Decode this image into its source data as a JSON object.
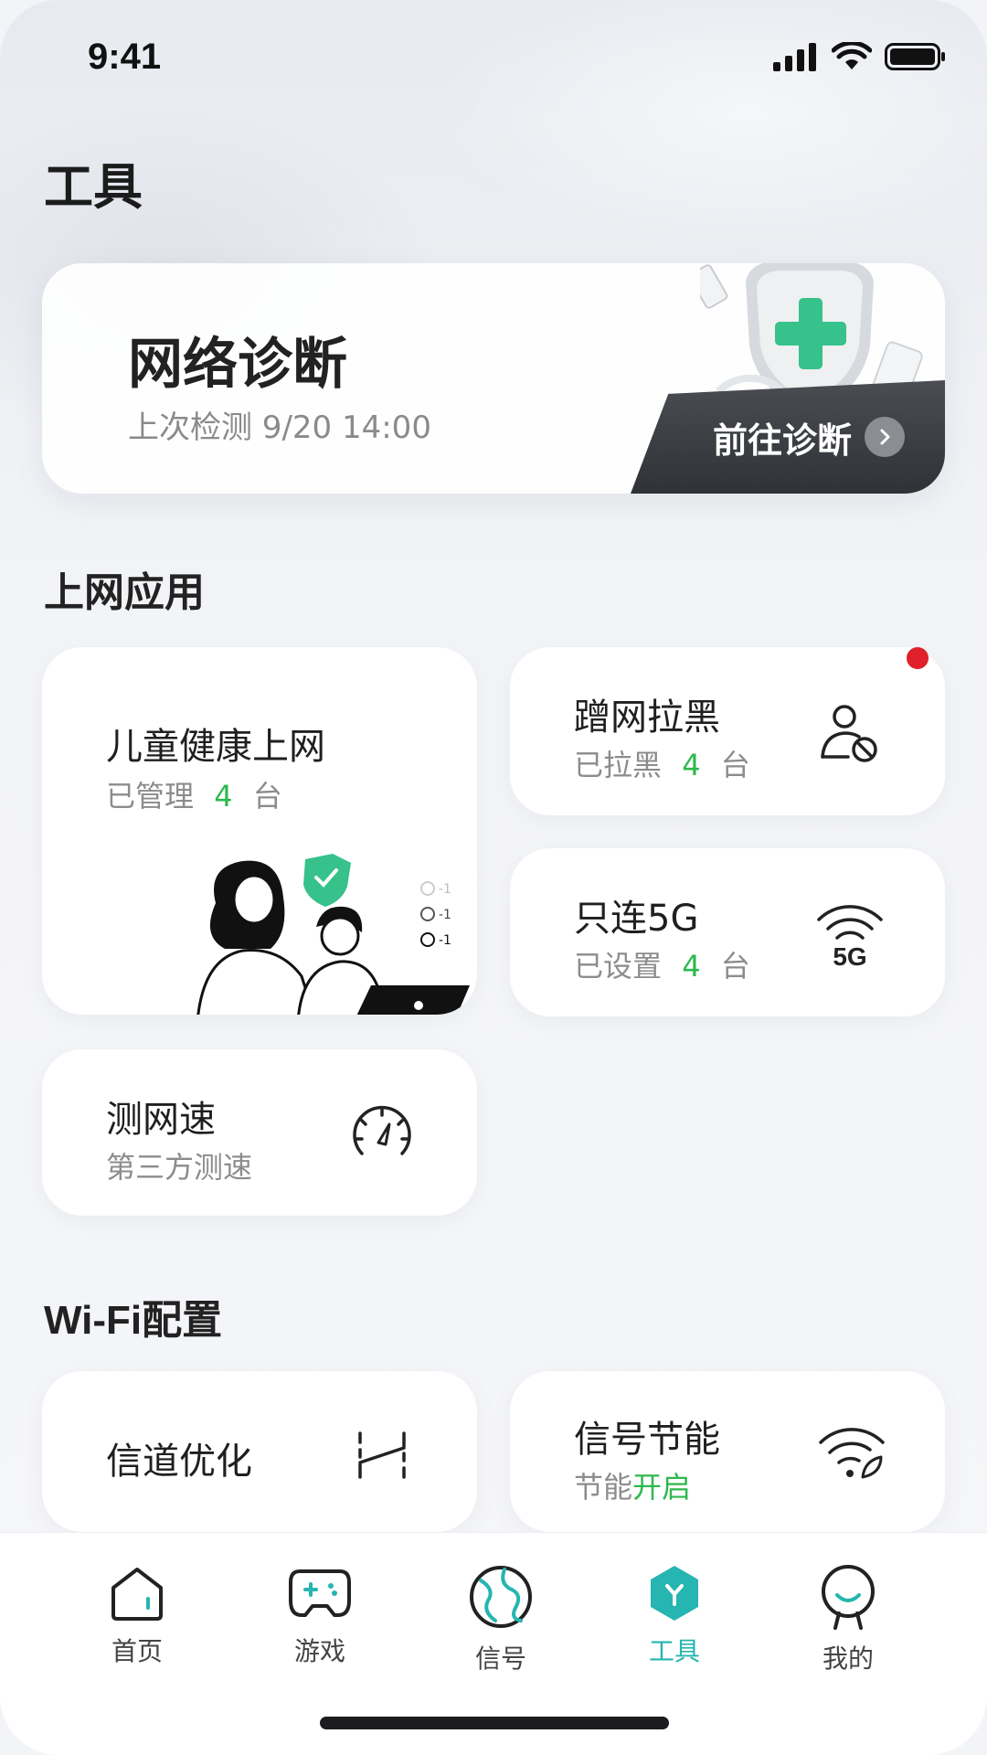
{
  "status_bar": {
    "time": "9:41"
  },
  "page_title": "工具",
  "diagnosis": {
    "title": "网络诊断",
    "subtitle": "上次检测 9/20 14:00",
    "button_label": "前往诊断"
  },
  "sections": {
    "internet_apps": "上网应用",
    "wifi_config": "Wi-Fi配置"
  },
  "cards": {
    "child": {
      "title": "儿童健康上网",
      "sub_prefix": "已管理",
      "count": "4",
      "unit": "台"
    },
    "blacklist": {
      "title": "蹭网拉黑",
      "sub_prefix": "已拉黑",
      "count": "4",
      "unit": "台"
    },
    "only5g": {
      "title": "只连5G",
      "sub_prefix": "已设置",
      "count": "4",
      "unit": "台"
    },
    "speed": {
      "title": "测网速",
      "sub": "第三方测速"
    },
    "channel": {
      "title": "信道优化"
    },
    "energy": {
      "title": "信号节能",
      "sub_prefix": "节能",
      "state": "开启"
    }
  },
  "illustration": {
    "timers": [
      "-1",
      "-1",
      "-1"
    ]
  },
  "tabs": [
    {
      "label": "首页",
      "icon": "home-icon"
    },
    {
      "label": "游戏",
      "icon": "gamepad-icon"
    },
    {
      "label": "信号",
      "icon": "globe-icon"
    },
    {
      "label": "工具",
      "icon": "tools-icon",
      "active": true
    },
    {
      "label": "我的",
      "icon": "profile-icon"
    }
  ],
  "colors": {
    "accent": "#26b5b0",
    "green": "#2db84d",
    "alert": "#e0202a"
  }
}
